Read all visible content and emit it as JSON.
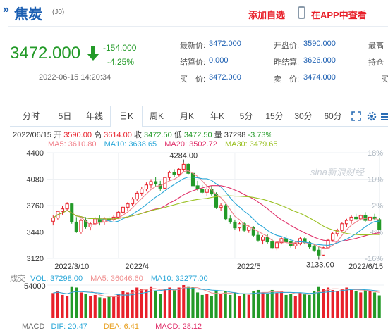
{
  "header": {
    "arrows": "»",
    "name": "焦炭",
    "code": "(J0)",
    "add_watchlist": "添加自选",
    "app_link": "在APP中查看"
  },
  "price": {
    "last": "3472.000",
    "change": "-154.000",
    "change_pct": "-4.25%",
    "timestamp": "2022-06-15 14:20:34"
  },
  "quote": {
    "latest_label": "最新价:",
    "latest": "3472.000",
    "settle_label": "结算价:",
    "settle": "0.000",
    "bid_label": "买　价:",
    "bid": "3472.000",
    "open_label": "开盘价:",
    "open": "3590.000",
    "prev_settle_label": "昨结算:",
    "prev_settle": "3626.000",
    "ask_label": "卖　价:",
    "ask": "3474.000",
    "high_label": "最高",
    "position_label": "持仓",
    "extra_label": "买"
  },
  "tabs": [
    "分时",
    "5日",
    "年线",
    "日K",
    "周K",
    "月K",
    "年K",
    "5分",
    "15分",
    "30分",
    "60分"
  ],
  "active_tab": "日K",
  "ohlc_bar": {
    "date": "2022/06/15",
    "open_label": "开",
    "open": "3590.00",
    "high_label": "高",
    "high": "3614.00",
    "close_label": "收",
    "close": "3472.50",
    "low_label": "低",
    "low": "3472.50",
    "vol_label": "量",
    "vol": "37298",
    "pct": "-3.73%"
  },
  "ma": {
    "ma5": "MA5: 3610.80",
    "ma10": "MA10: 3638.65",
    "ma20": "MA20: 3502.72",
    "ma30": "MA30: 3479.65"
  },
  "watermark": "sina新浪财经",
  "colors": {
    "up": "#e8202a",
    "down": "#239a28",
    "ma5": "#f0808a",
    "ma10": "#2aa7d8",
    "ma20": "#e0306a",
    "ma30": "#9ac022",
    "volume_ma5": "#f09090",
    "volume_ma10": "#2aa7d8"
  },
  "chart_data": {
    "type": "candlestick",
    "y_ticks": [
      "4400",
      "4080",
      "3760",
      "3440",
      "3120"
    ],
    "y_pct_ticks": [
      "18%",
      "10%",
      "2%",
      "-6%",
      "-16%"
    ],
    "x_ticks": [
      "2022/3/10",
      "2022/4",
      "2022/5",
      "2022/6/15"
    ],
    "ylim": [
      3120,
      4400
    ],
    "max_label": "4284.00",
    "min_label": "3133.00",
    "candles": [
      [
        3570,
        3640,
        3520,
        3610
      ],
      [
        3610,
        3700,
        3590,
        3690
      ],
      [
        3690,
        3760,
        3650,
        3720
      ],
      [
        3720,
        3800,
        3700,
        3780
      ],
      [
        3780,
        3790,
        3540,
        3560
      ],
      [
        3560,
        3620,
        3430,
        3440
      ],
      [
        3440,
        3600,
        3420,
        3580
      ],
      [
        3580,
        3620,
        3480,
        3500
      ],
      [
        3500,
        3560,
        3460,
        3540
      ],
      [
        3540,
        3620,
        3520,
        3600
      ],
      [
        3600,
        3640,
        3520,
        3560
      ],
      [
        3560,
        3620,
        3530,
        3600
      ],
      [
        3600,
        3630,
        3560,
        3590
      ],
      [
        3590,
        3640,
        3570,
        3620
      ],
      [
        3620,
        3700,
        3600,
        3680
      ],
      [
        3680,
        3760,
        3660,
        3740
      ],
      [
        3740,
        3800,
        3700,
        3780
      ],
      [
        3780,
        3860,
        3760,
        3840
      ],
      [
        3840,
        3930,
        3820,
        3910
      ],
      [
        3910,
        3990,
        3880,
        3960
      ],
      [
        3960,
        4040,
        3930,
        4010
      ],
      [
        4010,
        4080,
        3970,
        4050
      ],
      [
        4050,
        4110,
        3990,
        4020
      ],
      [
        4020,
        4060,
        3940,
        3970
      ],
      [
        3970,
        4110,
        3960,
        4100
      ],
      [
        4100,
        4180,
        4060,
        4160
      ],
      [
        4160,
        4200,
        4110,
        4140
      ],
      [
        4140,
        4220,
        4120,
        4200
      ],
      [
        4200,
        4284,
        4170,
        4260
      ],
      [
        4260,
        4280,
        4140,
        4150
      ],
      [
        4150,
        4160,
        3990,
        4000
      ],
      [
        4000,
        4060,
        3940,
        3960
      ],
      [
        3960,
        4010,
        3900,
        3920
      ],
      [
        3920,
        3990,
        3880,
        3960
      ],
      [
        3960,
        4000,
        3880,
        3900
      ],
      [
        3900,
        3920,
        3720,
        3740
      ],
      [
        3740,
        3790,
        3700,
        3760
      ],
      [
        3760,
        3780,
        3580,
        3600
      ],
      [
        3600,
        3640,
        3540,
        3560
      ],
      [
        3560,
        3590,
        3470,
        3490
      ],
      [
        3490,
        3560,
        3450,
        3540
      ],
      [
        3540,
        3560,
        3440,
        3460
      ],
      [
        3460,
        3520,
        3430,
        3500
      ],
      [
        3500,
        3510,
        3380,
        3400
      ],
      [
        3400,
        3440,
        3320,
        3340
      ],
      [
        3340,
        3400,
        3290,
        3380
      ],
      [
        3380,
        3410,
        3300,
        3320
      ],
      [
        3320,
        3360,
        3230,
        3250
      ],
      [
        3250,
        3330,
        3220,
        3310
      ],
      [
        3310,
        3380,
        3290,
        3360
      ],
      [
        3360,
        3400,
        3300,
        3320
      ],
      [
        3320,
        3340,
        3250,
        3270
      ],
      [
        3270,
        3320,
        3240,
        3300
      ],
      [
        3300,
        3380,
        3280,
        3360
      ],
      [
        3360,
        3380,
        3290,
        3310
      ],
      [
        3310,
        3330,
        3240,
        3260
      ],
      [
        3260,
        3290,
        3200,
        3220
      ],
      [
        3220,
        3260,
        3133,
        3160
      ],
      [
        3160,
        3260,
        3150,
        3250
      ],
      [
        3250,
        3360,
        3240,
        3340
      ],
      [
        3340,
        3440,
        3320,
        3420
      ],
      [
        3420,
        3480,
        3390,
        3460
      ],
      [
        3460,
        3560,
        3440,
        3540
      ],
      [
        3540,
        3600,
        3500,
        3580
      ],
      [
        3580,
        3640,
        3540,
        3620
      ],
      [
        3620,
        3660,
        3580,
        3600
      ],
      [
        3600,
        3650,
        3580,
        3640
      ],
      [
        3640,
        3680,
        3560,
        3580
      ],
      [
        3580,
        3640,
        3560,
        3620
      ],
      [
        3620,
        3660,
        3580,
        3600
      ],
      [
        3590,
        3614,
        3472,
        3472
      ]
    ]
  },
  "volume": {
    "label": "成交",
    "vol_label": "VOL: 37298.00",
    "ma5_label": "MA5: 36046.60",
    "ma10_label": "MA10: 32277.00",
    "y_tick": "54000",
    "values": [
      41000,
      44000,
      38000,
      36000,
      52000,
      50000,
      42000,
      40000,
      36000,
      38000,
      34000,
      33000,
      35000,
      36000,
      40000,
      44000,
      42000,
      46000,
      50000,
      48000,
      47000,
      52000,
      44000,
      40000,
      48000,
      50000,
      46000,
      50000,
      54000,
      52000,
      50000,
      42000,
      38000,
      40000,
      36000,
      46000,
      40000,
      44000,
      38000,
      42000,
      36000,
      40000,
      38000,
      44000,
      46000,
      42000,
      40000,
      46000,
      42000,
      44000,
      38000,
      40000,
      36000,
      42000,
      40000,
      38000,
      44000,
      52000,
      48000,
      50000,
      46000,
      44000,
      48000,
      50000,
      46000,
      44000,
      42000,
      46000,
      44000,
      42000,
      37298
    ]
  },
  "macd": {
    "label": "MACD",
    "dif": "DIF: 20.47",
    "dea": "DEA: 6.41",
    "macd": "MACD: 28.12"
  }
}
